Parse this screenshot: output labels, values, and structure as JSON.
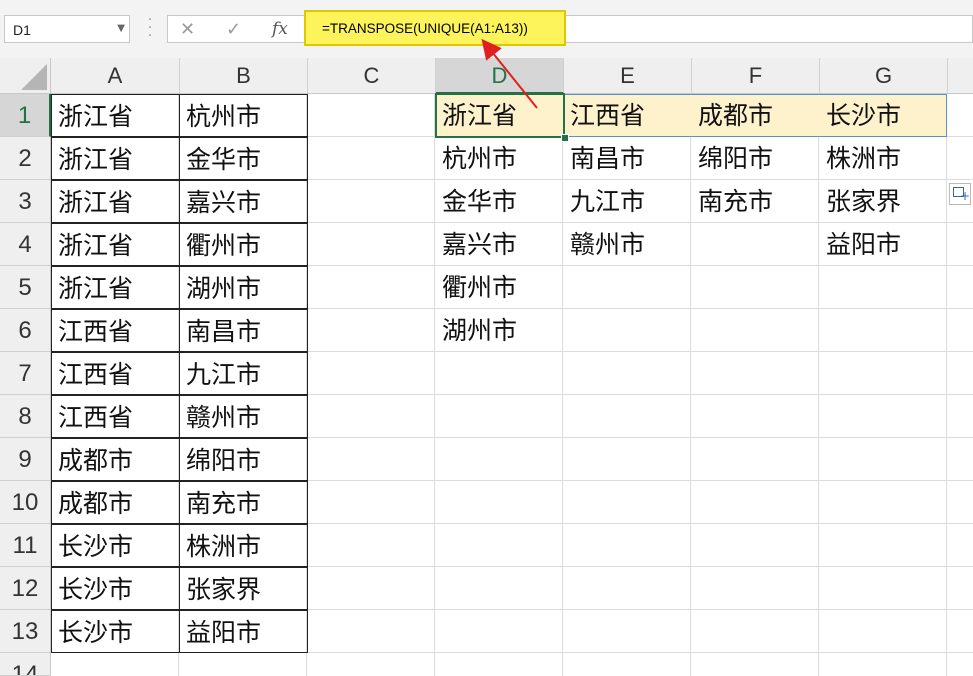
{
  "name_box": {
    "value": "D1"
  },
  "formula_bar": {
    "cancel": "✕",
    "enter": "✓",
    "fx": "fx",
    "formula": "=TRANSPOSE(UNIQUE(A1:A13))"
  },
  "columns": [
    "A",
    "B",
    "C",
    "D",
    "E",
    "F",
    "G"
  ],
  "rows": [
    "1",
    "2",
    "3",
    "4",
    "5",
    "6",
    "7",
    "8",
    "9",
    "10",
    "11",
    "12",
    "13",
    "14"
  ],
  "selected": {
    "column": "D",
    "row": "1"
  },
  "colA": [
    "浙江省",
    "浙江省",
    "浙江省",
    "浙江省",
    "浙江省",
    "江西省",
    "江西省",
    "江西省",
    "成都市",
    "成都市",
    "长沙市",
    "长沙市",
    "长沙市"
  ],
  "colB": [
    "杭州市",
    "金华市",
    "嘉兴市",
    "衢州市",
    "湖州市",
    "南昌市",
    "九江市",
    "赣州市",
    "绵阳市",
    "南充市",
    "株洲市",
    "张家界",
    "益阳市"
  ],
  "colD": [
    "浙江省",
    "杭州市",
    "金华市",
    "嘉兴市",
    "衢州市",
    "湖州市"
  ],
  "colE": [
    "江西省",
    "南昌市",
    "九江市",
    "赣州市"
  ],
  "colF": [
    "成都市",
    "绵阳市",
    "南充市"
  ],
  "colG": [
    "长沙市",
    "株洲市",
    "张家界",
    "益阳市"
  ],
  "colors": {
    "active": "#217346",
    "highlight": "#fdf2cc",
    "formula_highlight": "#fdf35a",
    "arrow": "#e02020"
  }
}
